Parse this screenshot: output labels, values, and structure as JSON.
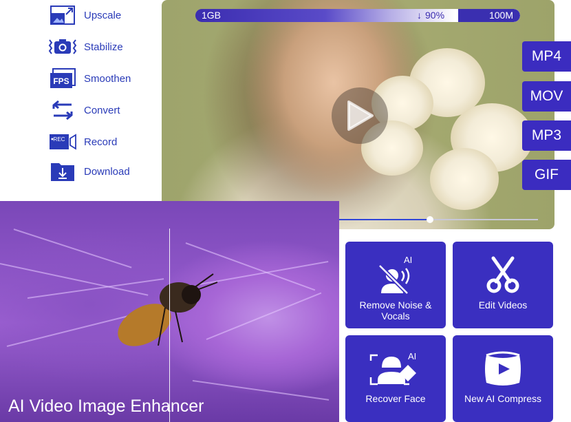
{
  "menu": {
    "items": [
      {
        "label": "Upscale",
        "icon": "upscale-icon"
      },
      {
        "label": "Stabilize",
        "icon": "camera-stabilize-icon"
      },
      {
        "label": "Smoothen",
        "icon": "fps-icon",
        "icon_text": "FPS"
      },
      {
        "label": "Convert",
        "icon": "convert-arrows-icon"
      },
      {
        "label": "Record",
        "icon": "record-icon",
        "icon_text": "REC"
      },
      {
        "label": "Download",
        "icon": "download-folder-icon"
      }
    ]
  },
  "video": {
    "size_start": "1GB",
    "size_percent": "90%",
    "size_end": "100M",
    "progress": 0.7
  },
  "formats": [
    "MP4",
    "MOV",
    "MP3",
    "GIF"
  ],
  "photo": {
    "caption": "AI Video Image Enhancer"
  },
  "tools": [
    {
      "label": "Remove Noise & Vocals",
      "icon": "remove-noise-icon",
      "badge": "AI"
    },
    {
      "label": "Edit Videos",
      "icon": "scissors-icon"
    },
    {
      "label": "Recover Face",
      "icon": "recover-face-icon",
      "badge": "AI"
    },
    {
      "label": "New AI Compress",
      "icon": "compress-video-icon"
    }
  ],
  "colors": {
    "accent": "#3a2fc0",
    "menu_text": "#2a3bb8",
    "seek_fill": "#3045d8"
  }
}
